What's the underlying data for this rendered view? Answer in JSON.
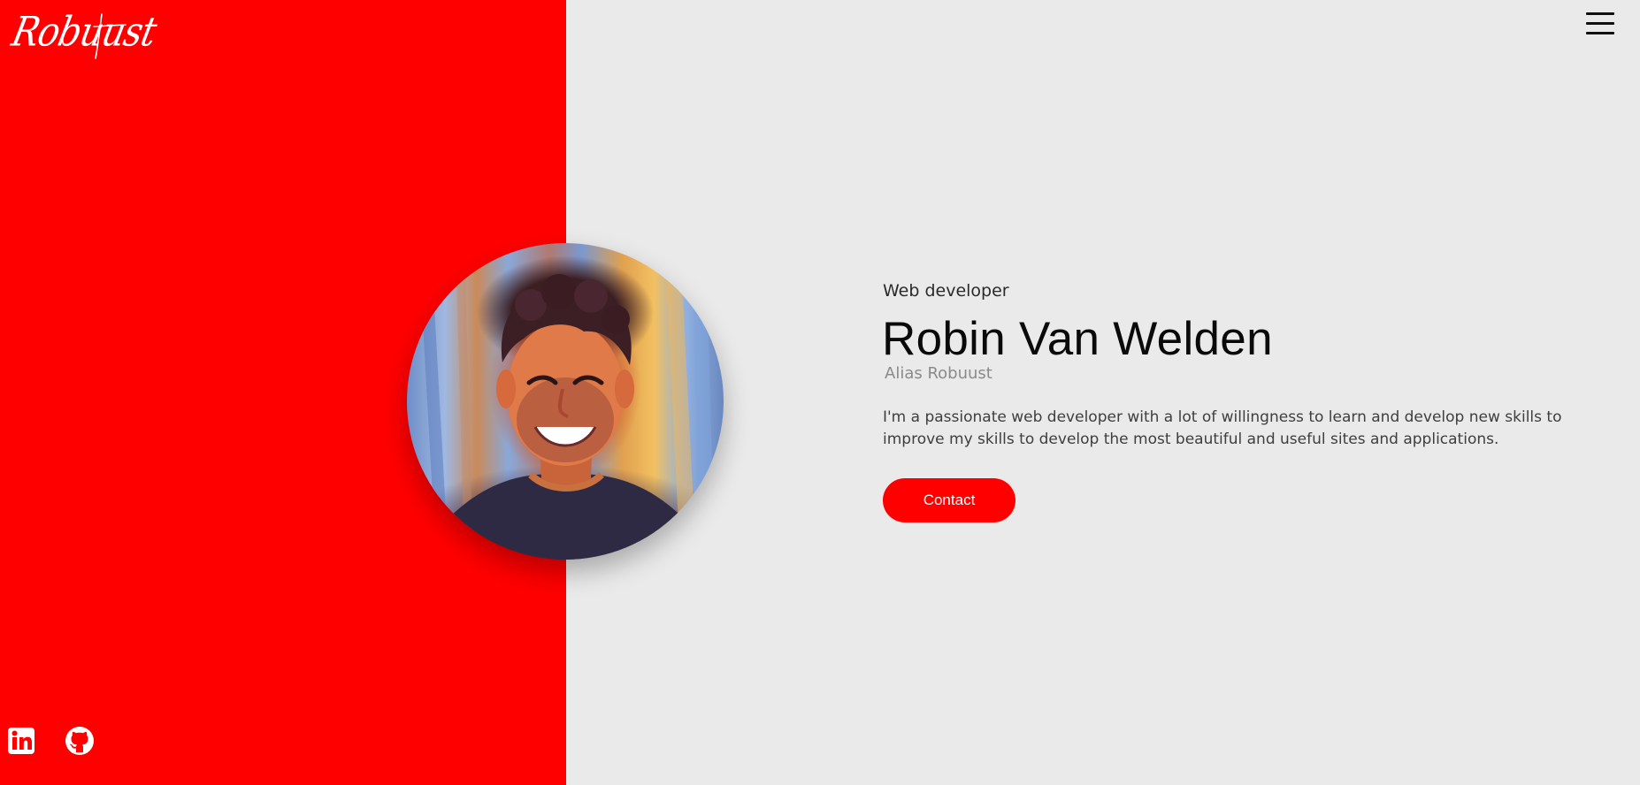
{
  "brand": {
    "logo_text": "Robuust"
  },
  "header": {
    "menu_icon": "hamburger-menu-icon"
  },
  "hero": {
    "portrait_alt": "Robin Van Welden",
    "subtitle": "Web developer",
    "name": "Robin Van Welden",
    "alias": "Alias Robuust",
    "bio": "I'm a passionate web developer with a lot of willingness to learn and develop new skills to improve my skills to develop the most beautiful and useful sites and applications.",
    "contact_label": "Contact"
  },
  "social": {
    "items": [
      {
        "icon": "linkedin-icon"
      },
      {
        "icon": "github-icon"
      }
    ]
  },
  "colors": {
    "accent": "#ff0000",
    "background": "#eaeaea",
    "heading": "#0a0a0a",
    "muted": "#8a8a8a",
    "body_text": "#3e3e3e"
  }
}
